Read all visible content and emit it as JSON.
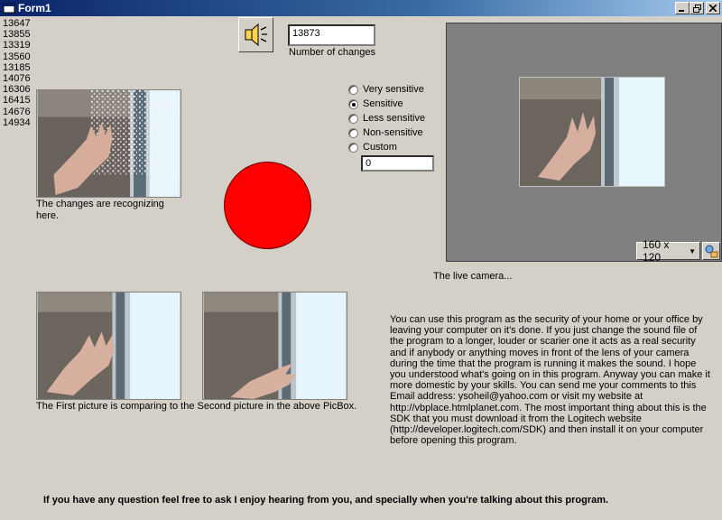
{
  "window": {
    "title": "Form1"
  },
  "changes_history": [
    "13647",
    "13855",
    "13319",
    "13560",
    "13185",
    "14076",
    "16306",
    "16415",
    "14676",
    "14934"
  ],
  "change_count": {
    "value": "13873",
    "label": "Number of changes"
  },
  "sensitivity": {
    "options": [
      "Very sensitive",
      "Sensitive",
      "Less sensitive",
      "Non-sensitive",
      "Custom"
    ],
    "selected": "Sensitive",
    "custom_value": "0"
  },
  "captions": {
    "changes": "The changes are recognizing here.",
    "compare": "The First picture is comparing to the Second picture in the above PicBox.",
    "live": "The live camera..."
  },
  "camera": {
    "resolution": "160 x 120"
  },
  "description": "You can use this program as the security of your home or your office by leaving your computer on it's done. If you just change the sound file of the program to a longer, louder or scarier one it acts as a real security and if anybody or anything moves in front of the lens of your camera during the time that the program is running it makes the sound. I hope you understood what's going on in this program. Anyway you can make it more domestic by your skills. You can send me your comments to this Email address: ysoheil@yahoo.com or visit my website at http://vbplace.htmlplanet.com. The most important thing about this is the SDK that you must download it from the Logitech website (http://developer.logitech.com/SDK) and then install it on your computer before opening this program.",
  "footer": "If you have any question feel free to ask I enjoy hearing from you, and specially when you're talking about this program.",
  "colors": {
    "indicator": "#ff0000",
    "titlebar": "#0a246a",
    "form": "#d4d0c8"
  },
  "icons": [
    "app-icon",
    "minimize-icon",
    "restore-icon",
    "close-icon",
    "speaker-icon",
    "dropdown-arrow-icon",
    "camera-settings-icon"
  ]
}
